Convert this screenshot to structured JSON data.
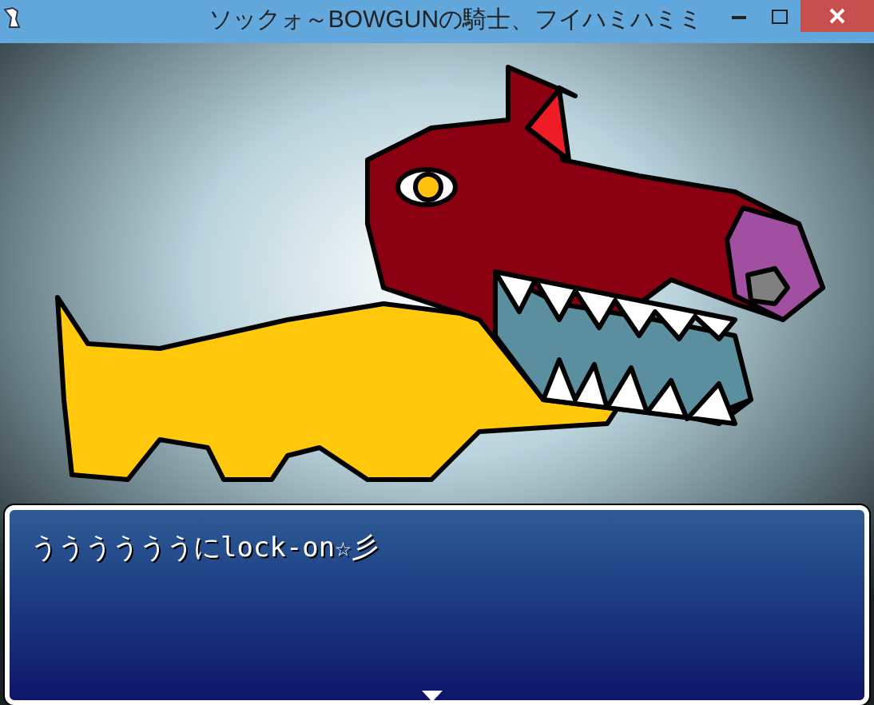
{
  "window": {
    "title": "ソックォ～BOWGUNの騎士、フイハミハミミ"
  },
  "message": {
    "text": "ううううううにlock-on☆彡"
  }
}
